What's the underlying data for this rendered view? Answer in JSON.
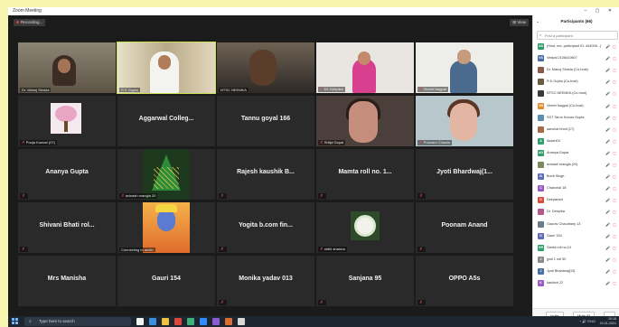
{
  "window": {
    "app_title": "Zoom Meeting",
    "controls": "–  ▢  ✕"
  },
  "recording": {
    "label": "Recording..."
  },
  "view_button": {
    "label": "⊞ View"
  },
  "tiles": [
    {
      "label": "Dr. Manoj Shukla",
      "kind": "office",
      "muted": false
    },
    {
      "label": "R K Gupta",
      "kind": "shelf",
      "muted": false,
      "active": true
    },
    {
      "label": "NTSC NEEMKA",
      "kind": "dark",
      "muted": false
    },
    {
      "label": "Dr. Deepika",
      "kind": "pink",
      "muted": true
    },
    {
      "label": "Vineet Nagpal",
      "kind": "man2",
      "muted": true
    },
    {
      "label": "Pooja Kumari (07)",
      "kind": "tree",
      "muted": true
    },
    {
      "name": "Aggarwal Colleg...",
      "kind": "text",
      "muted": false
    },
    {
      "name": "Tannu goyal 166",
      "kind": "text",
      "muted": false
    },
    {
      "label": "Shilpi Goyal",
      "kind": "woman1",
      "muted": true
    },
    {
      "label": "Poonam Chawla",
      "kind": "woman2",
      "muted": true
    },
    {
      "name": "Ananya Gupta",
      "kind": "text",
      "muted": true
    },
    {
      "label": "avinash mangla 20",
      "kind": "xmas",
      "muted": true
    },
    {
      "name": "Rajesh kaushik B...",
      "kind": "text",
      "muted": true
    },
    {
      "name": "Mamta roll no. 1...",
      "kind": "text",
      "muted": true
    },
    {
      "name": "Jyoti Bhardwaj(1...",
      "kind": "text",
      "muted": true
    },
    {
      "name": "Shivani Bhati rol...",
      "kind": "text",
      "muted": true
    },
    {
      "label": "Connecting to audio",
      "kind": "krishna",
      "muted": false
    },
    {
      "name": "Yogita b.com fin...",
      "kind": "text",
      "muted": true
    },
    {
      "label": "nidhi sharma",
      "kind": "flower",
      "muted": true
    },
    {
      "name": "Poonam Anand",
      "kind": "text",
      "muted": true
    },
    {
      "name": "Mrs Manisha",
      "kind": "text",
      "muted": false
    },
    {
      "name": "Gauri 154",
      "kind": "text",
      "muted": false
    },
    {
      "name": "Monika yadav 013",
      "kind": "text",
      "muted": true
    },
    {
      "name": "Sanjana 95",
      "kind": "text",
      "muted": true
    },
    {
      "name": "OPPO A5s",
      "kind": "text",
      "muted": true
    }
  ],
  "participants_panel": {
    "title": "Participants (66)",
    "search_placeholder": "Find a participant",
    "items": [
      {
        "initials": "AS",
        "color": "#2f9e6b",
        "name": "(Host, me, participant ID: 444008...)",
        "icons": "🎤 ▢"
      },
      {
        "initials": "VS",
        "color": "#4a6fa5",
        "name": "Vedpal 2108410607",
        "icons": "🎤 ▢"
      },
      {
        "initials": "",
        "color": "#8a5b4a",
        "name": "Dr. Manoj Shukla (Co-host)",
        "icons": "🎤 ▢"
      },
      {
        "initials": "",
        "color": "#6b5a3e",
        "name": "R K Gupta (Co-host)",
        "icons": "🎤 ▢"
      },
      {
        "initials": "",
        "color": "#3a3a3a",
        "name": "NTSC NEEMKA (Co-host)",
        "icons": "🎤 ▢"
      },
      {
        "initials": "VN",
        "color": "#e58a2b",
        "name": "Vineet Nagpal (Co-host)",
        "icons": "🎤 ▢"
      },
      {
        "initials": "",
        "color": "#5a8fb0",
        "name": "SST Tarun Kumar Gupta",
        "icons": "🎤 ▢"
      },
      {
        "initials": "",
        "color": "#a56b46",
        "name": "aanchal bhoti (17)",
        "icons": "🎤 ▢"
      },
      {
        "initials": "A",
        "color": "#2f9e6b",
        "name": "Akash04",
        "icons": "🎤 ▢"
      },
      {
        "initials": "AG",
        "color": "#2f9e6b",
        "name": "Ananya Gupta",
        "icons": "🎤 ▢"
      },
      {
        "initials": "",
        "color": "#7a8a5a",
        "name": "avinash mangla (20)",
        "icons": "🎤 ▢"
      },
      {
        "initials": "B",
        "color": "#5d6bb8",
        "name": "Bunti Singh",
        "icons": "🎤 ▢"
      },
      {
        "initials": "C",
        "color": "#9a5bc2",
        "name": "Chanchal 18",
        "icons": "🎤 ▢"
      },
      {
        "initials": "D",
        "color": "#d94c3b",
        "name": "Deepanshi",
        "icons": "🎤 ▢"
      },
      {
        "initials": "",
        "color": "#b05a8a",
        "name": "Dr. Deepika",
        "icons": "🎤 ▢"
      },
      {
        "initials": "",
        "color": "#6b7b8a",
        "name": "Gaurav Chaudhary 13",
        "icons": "🎤 ▢"
      },
      {
        "initials": "G",
        "color": "#5d6bb8",
        "name": "Gauri 154",
        "icons": "🎤 ▢"
      },
      {
        "initials": "GR",
        "color": "#2f9e6b",
        "name": "Geeta roll no.10",
        "icons": "🎤 ▢"
      },
      {
        "initials": "J",
        "color": "#8a8a8a",
        "name": "jyoti 1 roll 50",
        "icons": "🎤 ▢"
      },
      {
        "initials": "J",
        "color": "#4a6fa5",
        "name": "Jyoti Bhardwaj(13)",
        "icons": "🎤 ▢"
      },
      {
        "initials": "K",
        "color": "#9a5bc2",
        "name": "kashish 22",
        "icons": "🎤 ▢"
      }
    ],
    "footer": {
      "invite": "Invite",
      "mute_all": "Mute All",
      "more": "..."
    }
  },
  "taskbar": {
    "search_placeholder": "Type here to search",
    "tray": "^ 🔊 ENG",
    "time": "10:18",
    "date": "20-01-2021",
    "app_colors": [
      "#f2f2f2",
      "#3b8fe0",
      "#f0c23b",
      "#e0453b",
      "#3bb37a",
      "#2d8cff",
      "#8a5bd0",
      "#e06c2e",
      "#d8d8d8"
    ]
  }
}
